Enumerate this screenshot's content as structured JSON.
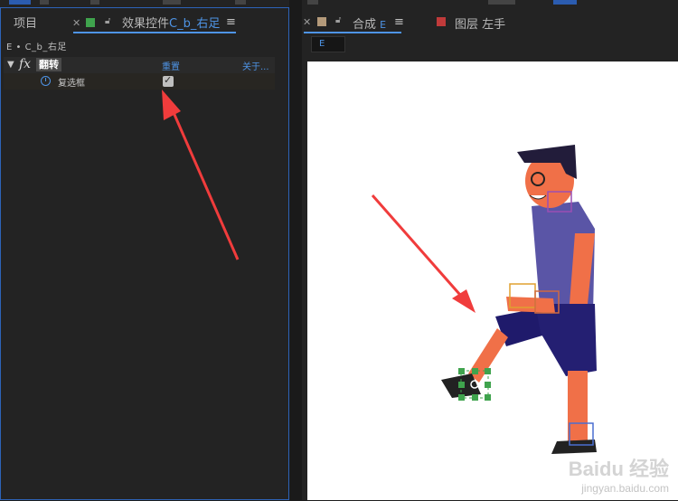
{
  "left_panel": {
    "project_tab": "项目",
    "effects_tab_prefix": "效果控件",
    "effects_tab_layer": "C_b_右足",
    "breadcrumb": "E • C_b_右足",
    "effect": {
      "name": "翻转",
      "reset_label": "重置",
      "about_label": "关于...",
      "checkbox_label": "复选框",
      "checkbox_checked": true
    }
  },
  "right_panel": {
    "comp_tab_prefix": "合成",
    "comp_tab_name": "E",
    "layer_tab": "图层 左手",
    "comp_field": "E"
  },
  "watermark": {
    "main": "Baidu 经验",
    "sub": "jingyan.baidu.com"
  },
  "colors": {
    "accent_blue": "#4e94e6",
    "tab_green": "#3fa34d",
    "tab_tan": "#b49a7a",
    "tab_red": "#c03a3a",
    "arrow_red": "#f03c3c"
  }
}
